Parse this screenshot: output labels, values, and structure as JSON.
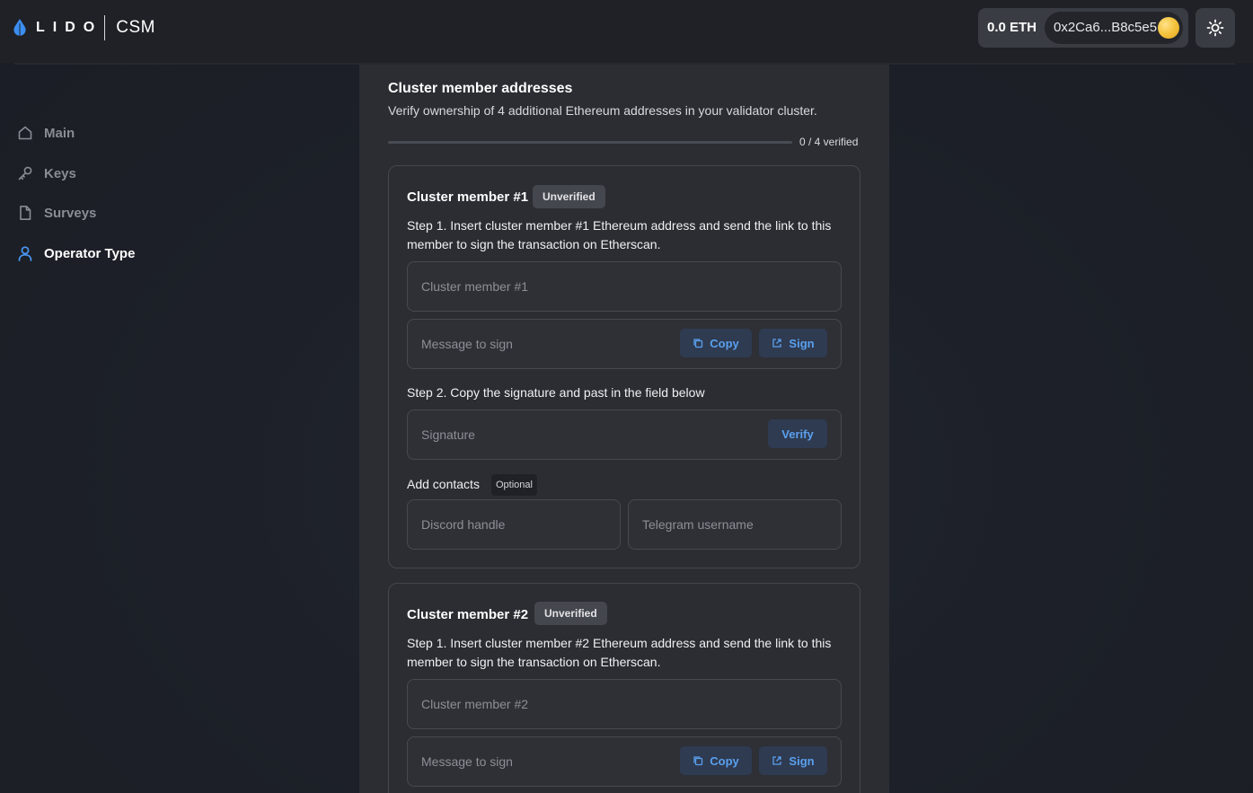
{
  "header": {
    "logo_text": "LIDO",
    "app_name": "CSM",
    "balance": "0.0 ETH",
    "address": "0x2Ca6...B8c5e5",
    "accent_color": "#3b8ef0"
  },
  "sidebar": {
    "items": [
      {
        "label": "Main",
        "icon": "home-icon",
        "active": false
      },
      {
        "label": "Keys",
        "icon": "key-icon",
        "active": false
      },
      {
        "label": "Surveys",
        "icon": "document-icon",
        "active": false
      },
      {
        "label": "Operator Type",
        "icon": "user-icon",
        "active": true
      }
    ]
  },
  "section": {
    "title": "Cluster member addresses",
    "description": "Verify ownership of 4 additional Ethereum addresses in your validator cluster.",
    "progress_text": "0 / 4 verified",
    "progress_fraction": 0
  },
  "members": [
    {
      "title": "Cluster member #1",
      "status": "Unverified",
      "step1": "Step 1. Insert cluster member #1 Ethereum address and send the link to this member to sign the transaction on Etherscan.",
      "address_placeholder": "Cluster member #1",
      "message_placeholder": "Message to sign",
      "copy_label": "Copy",
      "sign_label": "Sign",
      "step2": "Step 2. Copy the signature and past in the field below",
      "signature_placeholder": "Signature",
      "verify_label": "Verify",
      "contacts_label": "Add contacts",
      "optional_label": "Optional",
      "discord_placeholder": "Discord handle",
      "telegram_placeholder": "Telegram username"
    },
    {
      "title": "Cluster member #2",
      "status": "Unverified",
      "step1": "Step 1. Insert cluster member #2 Ethereum address and send the link to this member to sign the transaction on Etherscan.",
      "address_placeholder": "Cluster member #2",
      "message_placeholder": "Message to sign",
      "copy_label": "Copy",
      "sign_label": "Sign"
    }
  ]
}
